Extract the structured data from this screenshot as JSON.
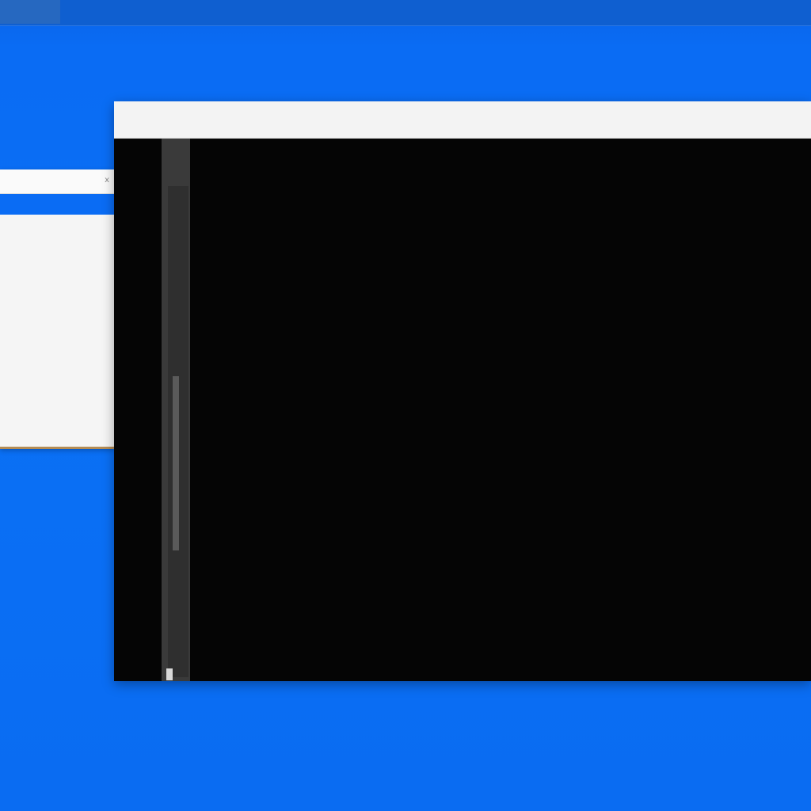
{
  "background_window": {
    "title": "x",
    "lines": [
      "",
      "",
      "",
      ""
    ]
  },
  "terminal": {
    "title": "",
    "lines": [
      "",
      "",
      "",
      "",
      "",
      "",
      "",
      "",
      "",
      "",
      "",
      "",
      "",
      "",
      "",
      "",
      "",
      "",
      "",
      "",
      "",
      "",
      "",
      "",
      "",
      "",
      "",
      "",
      "",
      "",
      "",
      "",
      "",
      "",
      "",
      "",
      "",
      ""
    ]
  },
  "colors": {
    "desktop": "#0a6ef2",
    "terminal_bg": "#050505",
    "terminal_text": "#d8d8d8",
    "titlebar": "#f3f3f3"
  }
}
